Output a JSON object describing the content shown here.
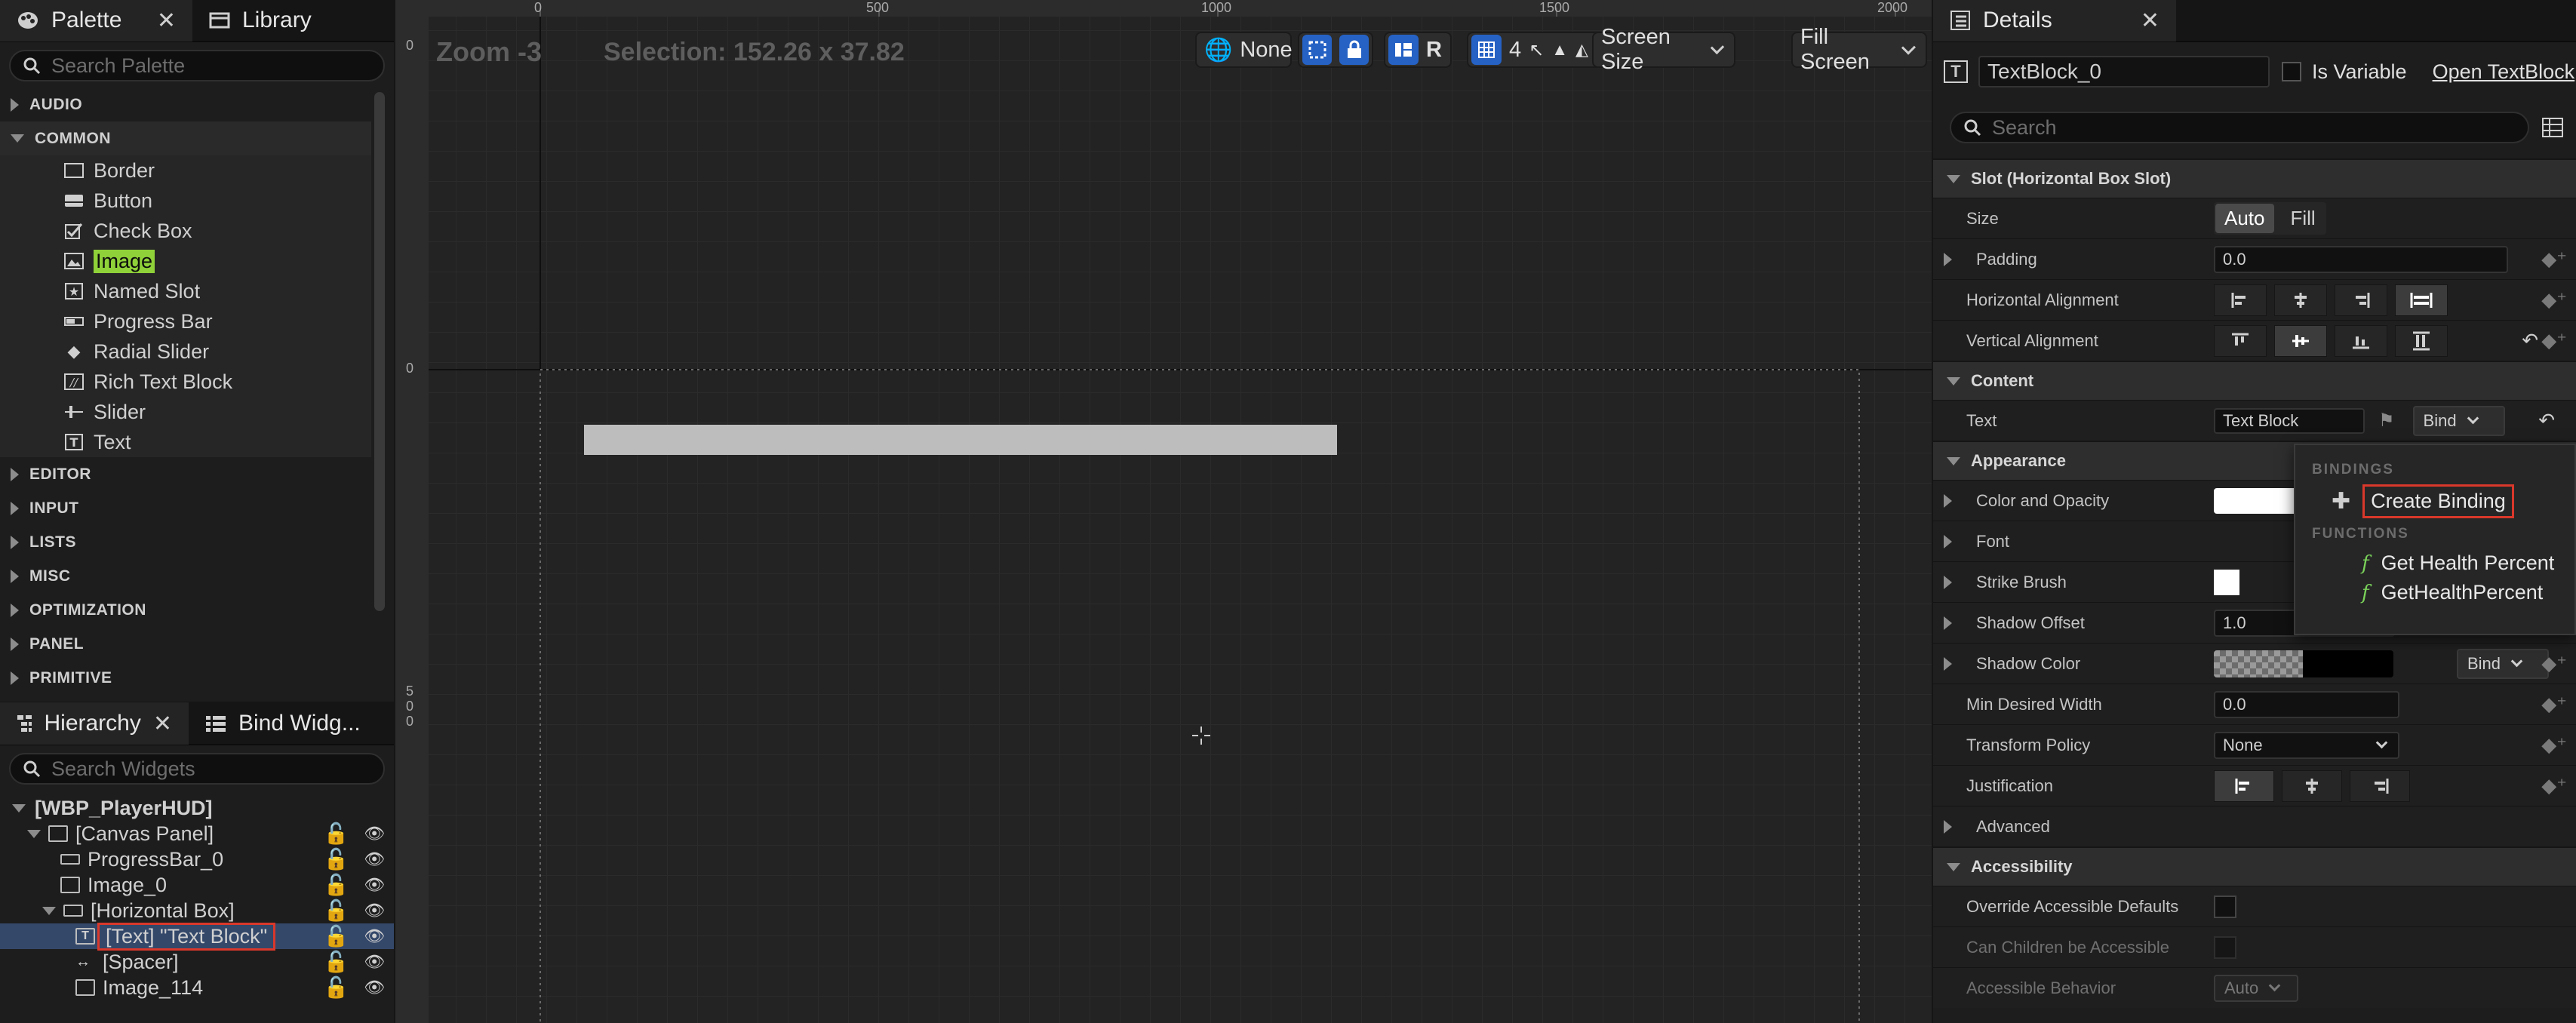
{
  "palette": {
    "tab_label": "Palette",
    "library_tab_label": "Library",
    "search_placeholder": "Search Palette",
    "categories_top": [
      "AUDIO",
      "COMMON"
    ],
    "common_items": [
      "Border",
      "Button",
      "Check Box",
      "Image",
      "Named Slot",
      "Progress Bar",
      "Radial Slider",
      "Rich Text Block",
      "Slider",
      "Text"
    ],
    "highlighted_item": "Image",
    "categories_bottom": [
      "EDITOR",
      "INPUT",
      "LISTS",
      "MISC",
      "OPTIMIZATION",
      "PANEL",
      "PRIMITIVE"
    ]
  },
  "hierarchy": {
    "tab_label": "Hierarchy",
    "bind_tab_label": "Bind Widg...",
    "search_placeholder": "Search Widgets",
    "rows": [
      {
        "label": "[WBP_PlayerHUD]"
      },
      {
        "label": "[Canvas Panel]"
      },
      {
        "label": "ProgressBar_0"
      },
      {
        "label": "Image_0"
      },
      {
        "label": "[Horizontal Box]"
      },
      {
        "label": "[Text] \"Text Block\""
      },
      {
        "label": "[Spacer]"
      },
      {
        "label": "Image_114"
      }
    ]
  },
  "designer": {
    "zoom_label": "Zoom -3",
    "selection_label": "Selection: 152.26 x 37.82",
    "toolbar": {
      "none_label": "None",
      "r_label": "R",
      "grid_value": "4",
      "screen_size_label": "Screen Size",
      "fill_screen_label": "Fill Screen"
    },
    "ruler_h": [
      "0",
      "500",
      "1000",
      "1500",
      "2000"
    ],
    "ruler_v": [
      "0",
      "0",
      "5",
      "0",
      "0"
    ]
  },
  "details": {
    "tab_label": "Details",
    "widget_name": "TextBlock_0",
    "is_variable_label": "Is Variable",
    "open_label": "Open TextBlock",
    "search_placeholder": "Search",
    "sections": {
      "slot": "Slot (Horizontal Box Slot)",
      "content": "Content",
      "appearance": "Appearance",
      "accessibility": "Accessibility"
    },
    "size_label": "Size",
    "size_auto": "Auto",
    "size_fill": "Fill",
    "padding_label": "Padding",
    "padding_value": "0.0",
    "halign_label": "Horizontal Alignment",
    "valign_label": "Vertical Alignment",
    "text_label": "Text",
    "text_value": "Text Block",
    "bind_label": "Bind",
    "color_label": "Color and Opacity",
    "font_label": "Font",
    "strike_label": "Strike Brush",
    "shadow_offset_label": "Shadow Offset",
    "shadow_offset_value": "1.0",
    "shadow_color_label": "Shadow Color",
    "min_width_label": "Min Desired Width",
    "min_width_value": "0.0",
    "transform_label": "Transform Policy",
    "transform_value": "None",
    "justification_label": "Justification",
    "advanced_label": "Advanced",
    "override_access_label": "Override Accessible Defaults",
    "can_children_label": "Can Children be Accessible",
    "access_behavior_label": "Accessible Behavior",
    "access_behavior_value": "Auto"
  },
  "bind_popup": {
    "bindings_header": "BINDINGS",
    "create_binding": "Create Binding",
    "functions_header": "FUNCTIONS",
    "functions": [
      "Get Health Percent",
      "GetHealthPercent"
    ]
  },
  "colors": {
    "accent_blue": "#2662c4",
    "highlight_green": "#8fd139",
    "selection_red": "#d9382b"
  }
}
